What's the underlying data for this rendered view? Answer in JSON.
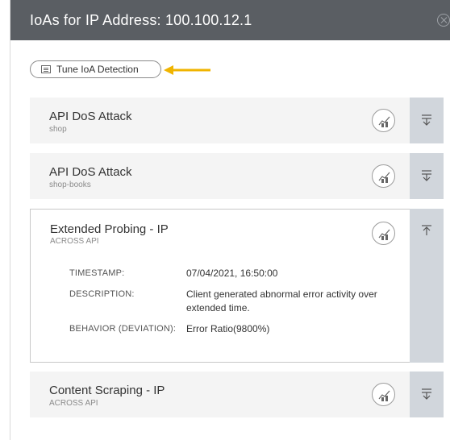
{
  "panel": {
    "title": "IoAs for IP Address: 100.100.12.1"
  },
  "toolbar": {
    "tune_label": "Tune IoA Detection"
  },
  "ioas": [
    {
      "title": "API DoS Attack",
      "subtitle": "shop"
    },
    {
      "title": "API DoS Attack",
      "subtitle": "shop-books"
    },
    {
      "title": "Extended Probing - IP",
      "subtitle": "ACROSS API",
      "details": [
        {
          "label": "TIMESTAMP:",
          "value": "07/04/2021, 16:50:00"
        },
        {
          "label": "DESCRIPTION:",
          "value": "Client generated abnormal error activity over extended time."
        },
        {
          "label": "BEHAVIOR (DEVIATION):",
          "value": "Error Ratio(9800%)"
        }
      ]
    },
    {
      "title": "Content Scraping - IP",
      "subtitle": "ACROSS API"
    }
  ],
  "colors": {
    "header_bg": "#5a5e63",
    "card_bg": "#f4f4f4",
    "side_bg": "#d1d6dc",
    "arrow": "#f0b400"
  },
  "icons": {
    "card_action": "chart-icon",
    "expand": "expand-down-icon",
    "collapse": "collapse-up-icon",
    "close": "close-icon",
    "tune": "list-icon"
  }
}
